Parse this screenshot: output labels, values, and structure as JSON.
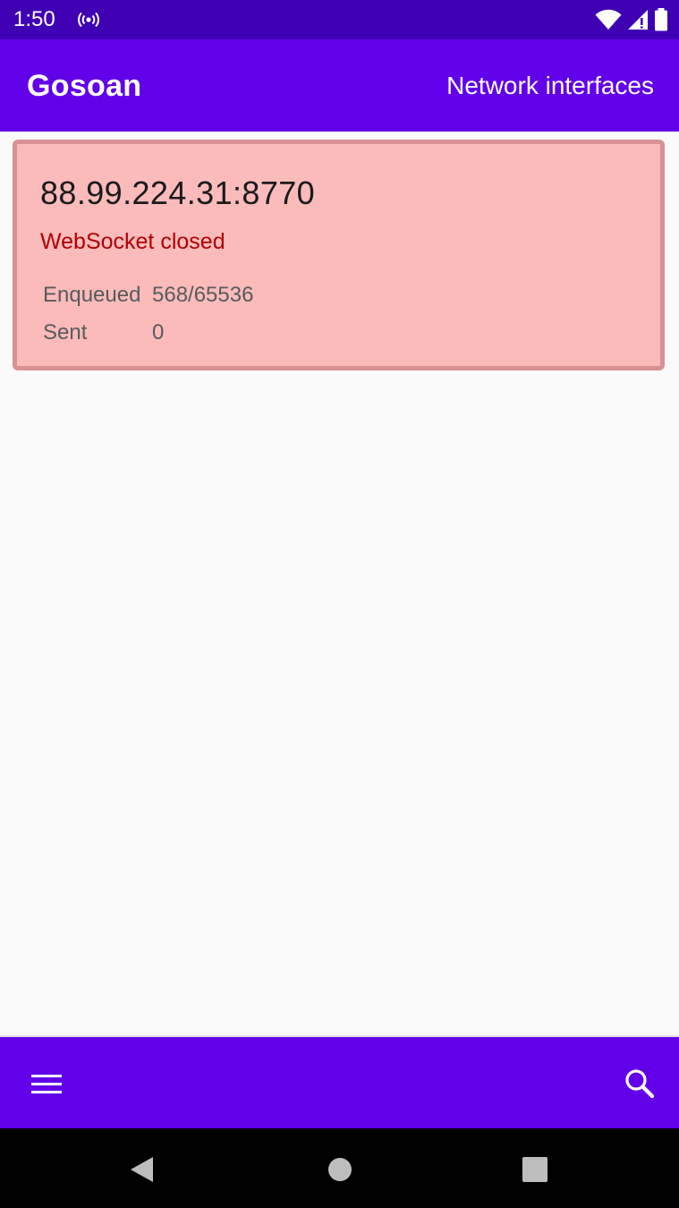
{
  "status_bar": {
    "time": "1:50",
    "icons": [
      "radio-broadcast-icon",
      "wifi-icon",
      "cell-signal-icon",
      "battery-icon"
    ],
    "background_color": "#3f00b4"
  },
  "app_bar": {
    "title": "Gosoan",
    "action_label": "Network interfaces",
    "background_color": "#6200ea"
  },
  "connection_card": {
    "address": "88.99.224.31:8770",
    "status": "WebSocket closed",
    "status_color": "#b00000",
    "background_color": "#fbbbbb",
    "stats": [
      {
        "label": "Enqueued",
        "value": "568/65536"
      },
      {
        "label": "Sent",
        "value": "0"
      }
    ]
  },
  "bottom_bar": {
    "icons": [
      "menu-icon",
      "search-icon"
    ]
  },
  "nav_bar": {
    "icons": [
      "back-icon",
      "home-icon",
      "recents-icon"
    ]
  }
}
